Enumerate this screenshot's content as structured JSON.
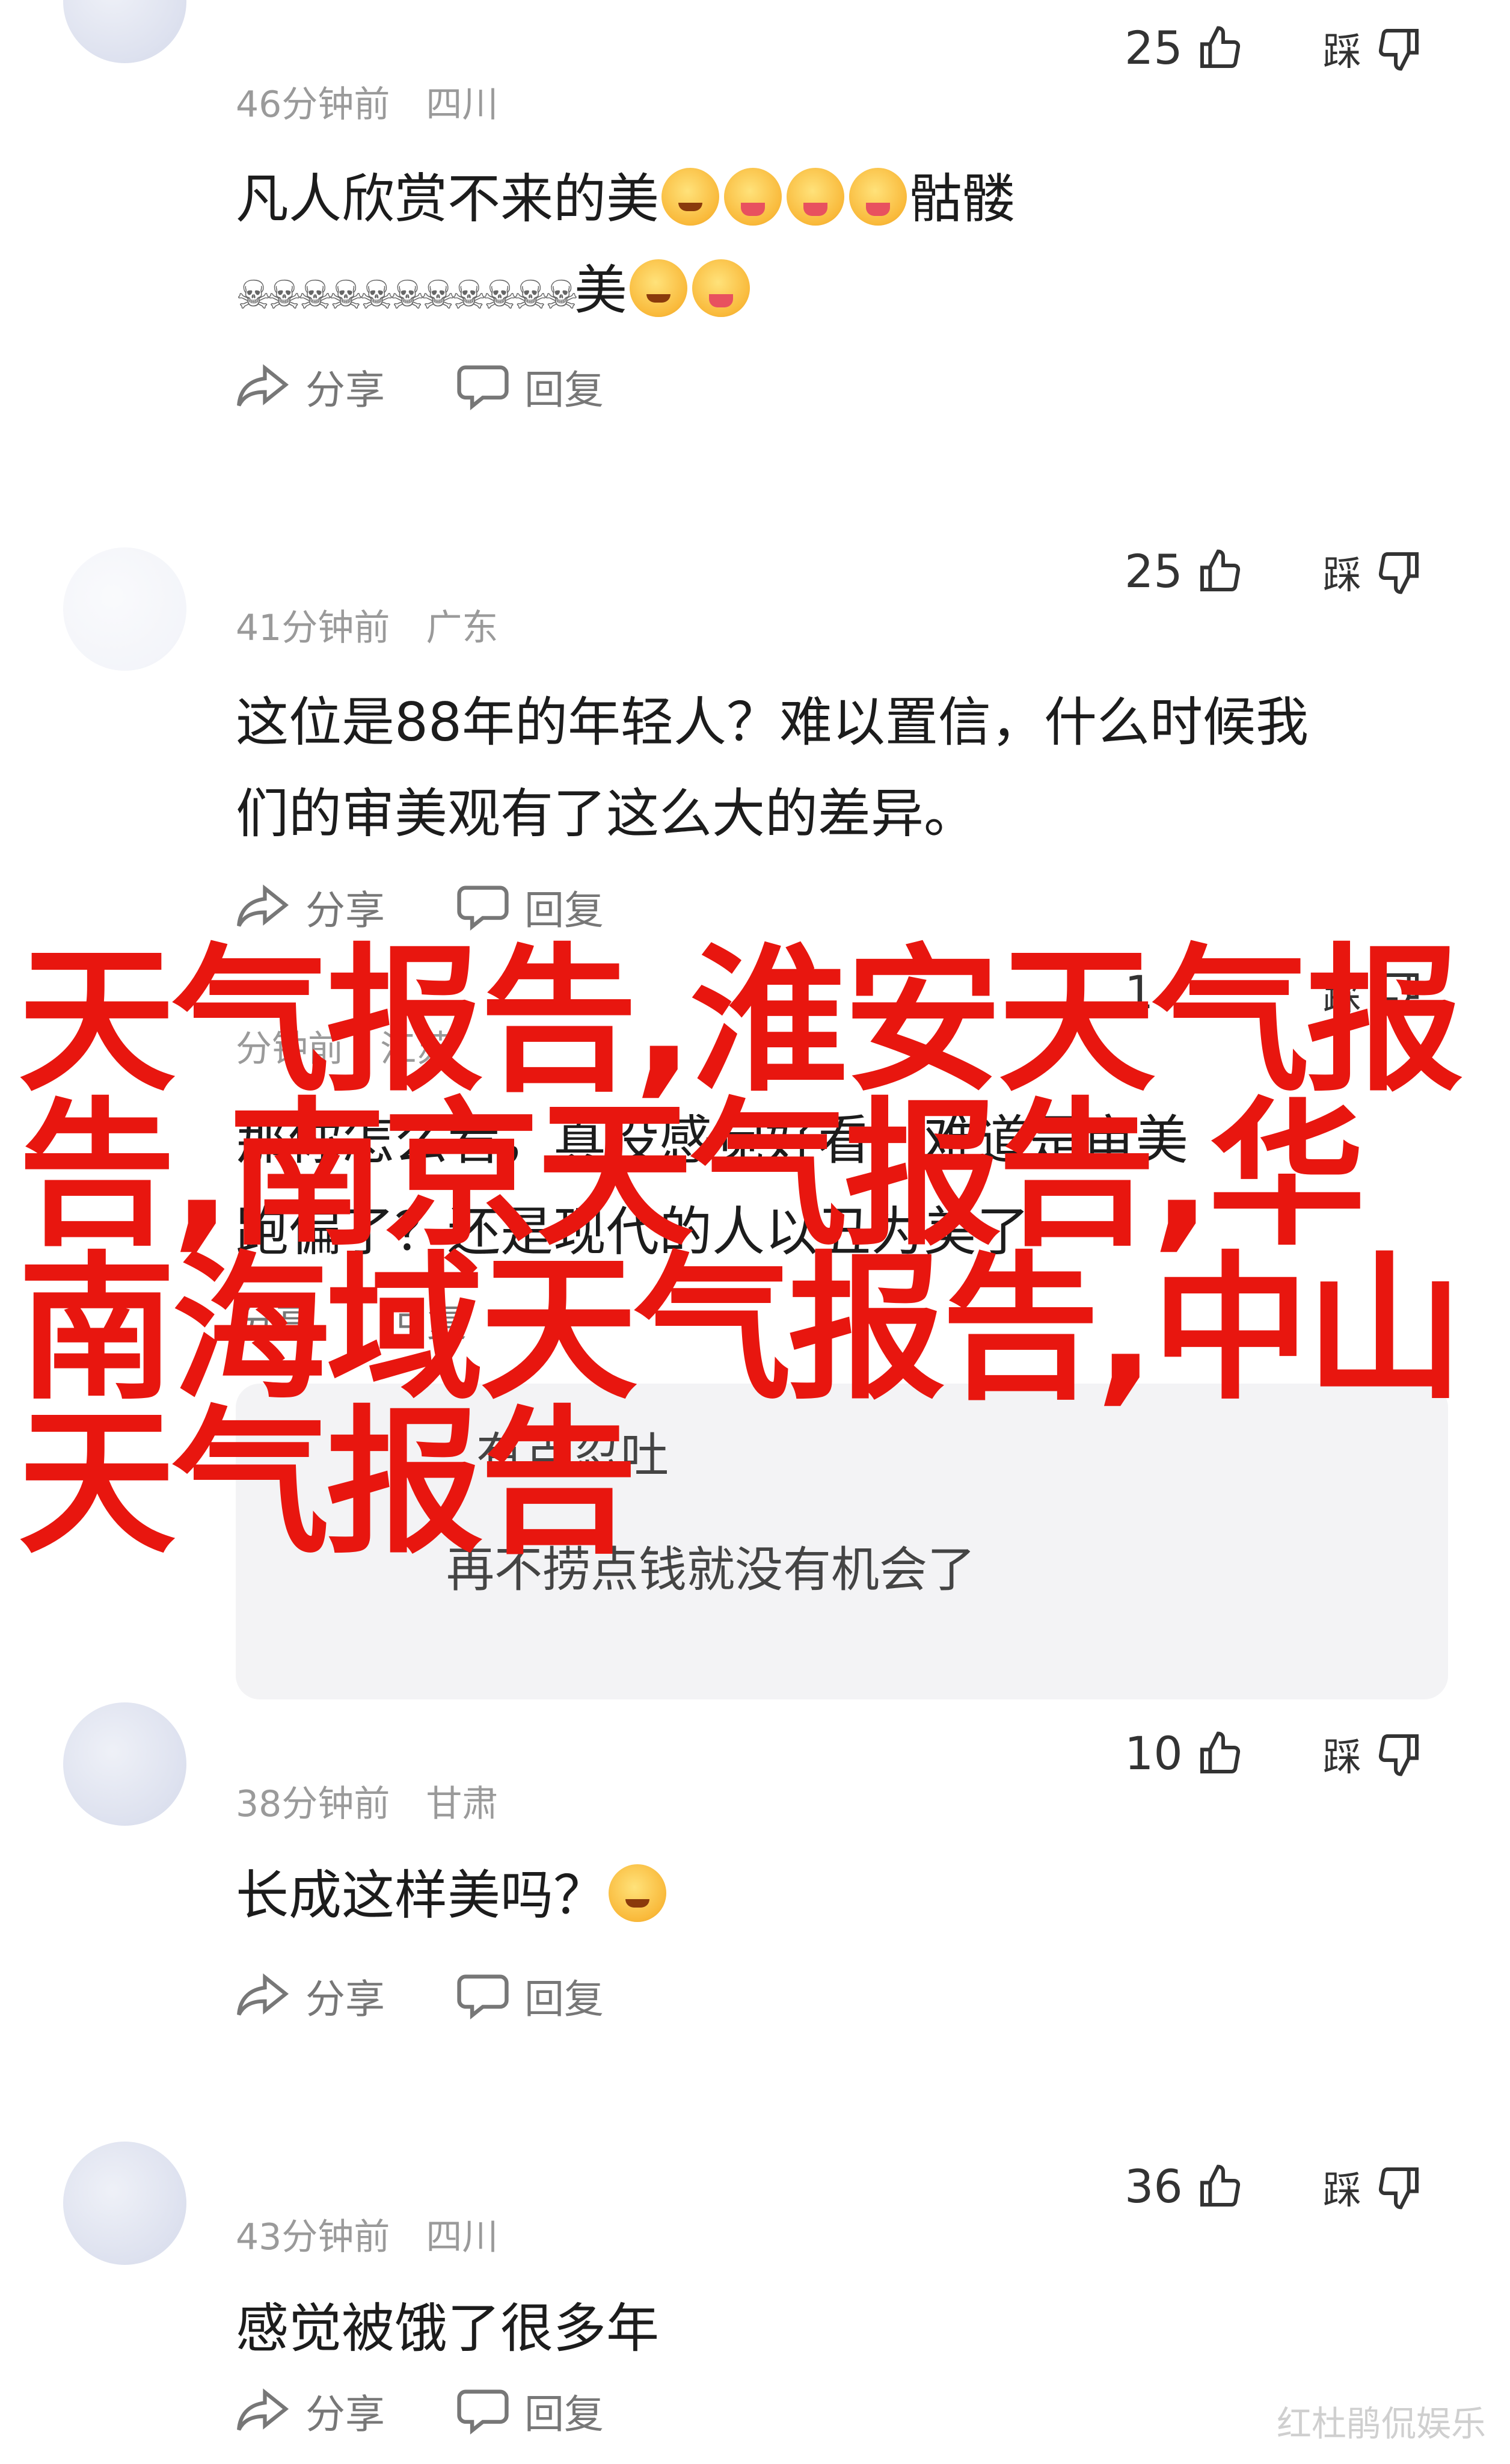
{
  "comments": [
    {
      "username": "",
      "time": "46分钟前",
      "location": "四川",
      "likes": "25",
      "dislike_label": "踩",
      "line1": "凡人欣赏不来的美",
      "line1_after": "骷髅",
      "line2_skulls": "☠☠☠☠☠☠☠☠☠☠☠",
      "line2_after": "美",
      "share_label": "分享",
      "reply_label": "回复"
    },
    {
      "username": "",
      "time": "41分钟前",
      "location": "广东",
      "likes": "25",
      "dislike_label": "踩",
      "line1": "这位是88年的年轻人？难以置信，什么时候我",
      "line2": "们的审美观有了这么大的差异。",
      "share_label": "分享",
      "reply_label": "回复"
    },
    {
      "username": "",
      "time": "分钟前",
      "location": "江苏",
      "likes": "1",
      "dislike_label": "踩",
      "line1": "那你怎么看，真没感觉好看，难道是审美",
      "line2": "跑偏了？还是现代的人以丑为美了",
      "share_label": "分享",
      "reply_label": "回复",
      "replies": [
        {
          "text": "有点忍吐"
        },
        {
          "text": "再不捞点钱就没有机会了"
        }
      ]
    },
    {
      "username": "",
      "time": "38分钟前",
      "location": "甘肃",
      "likes": "10",
      "dislike_label": "踩",
      "line1": "长成这样美吗？",
      "share_label": "分享",
      "reply_label": "回复"
    },
    {
      "username": "",
      "time": "43分钟前",
      "location": "四川",
      "likes": "36",
      "dislike_label": "踩",
      "line1": "感觉被饿了很多年",
      "share_label": "分享",
      "reply_label": "回复"
    }
  ],
  "headline": "天气报告,淮安天气报告,南京天气报告,华南海域天气报告,中山天气报告",
  "watermark": "红杜鹃侃娱乐",
  "colors": {
    "headline": "#e8160f",
    "meta": "#9a9a9a",
    "reply_bg": "#f3f3f5"
  }
}
